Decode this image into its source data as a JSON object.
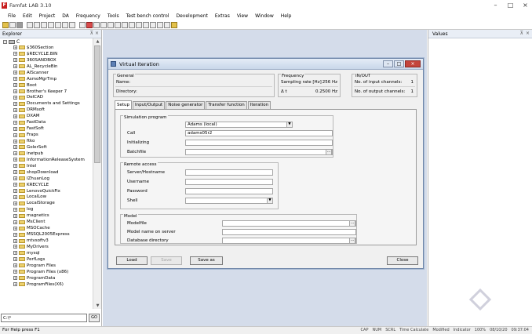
{
  "app": {
    "title": "Famfat LAB 3.10",
    "logo_letter": "F"
  },
  "window_controls": [
    "–",
    "□",
    "×"
  ],
  "menu": [
    "File",
    "Edit",
    "Project",
    "DA",
    "Frequency",
    "Tools",
    "Test bench control",
    "Development",
    "Extras",
    "View",
    "Window",
    "Help"
  ],
  "explorer": {
    "title": "Explorer",
    "pin": "⊼",
    "close": "×",
    "root": "C",
    "items": [
      "$360Section",
      "$RECYCLE.BIN",
      "360SANDBOX",
      "AL_RecycleBin",
      "AIScanner",
      "AsmoMgrTmp",
      "Boot",
      "Brother's Keeper 7",
      "DelCAD",
      "Documents and Settings",
      "DRMsoft",
      "DXAM",
      "FastData",
      "FastSoft",
      "Fraps",
      "ftko",
      "GolerSoft",
      "inetpub",
      "InformationReleaseSystem",
      "Intel",
      "shopDownload",
      "IZhuanLog",
      "KRECYCLE",
      "LenovoQuickFix",
      "LocalLow",
      "LocalStorage",
      "log",
      "magnetics",
      "MsClient",
      "MSOCache",
      "MSSQL2005Express",
      "mtvsoftv3",
      "MyDrivers",
      "mysql",
      "PerfLogs",
      "Program Files",
      "Program Files (x86)",
      "ProgramData",
      "ProgramFiles(X6)"
    ],
    "path": "C:\\*",
    "go": "GO"
  },
  "values_panel": {
    "title": "Values",
    "pin": "⊼",
    "close": "×"
  },
  "status": {
    "left": "For Help press F1",
    "indicators": [
      "CAP",
      "NUM",
      "SCRL",
      "Time Calculate",
      "Modified",
      "Indicator",
      "100%",
      "08/10/20",
      "09:37:04"
    ]
  },
  "dialog": {
    "title": "Virtual Iteration",
    "general": {
      "label": "General",
      "name_label": "Name:",
      "name_value": "",
      "dir_label": "Directory:",
      "dir_value": ""
    },
    "frequency": {
      "label": "Frequency",
      "sampling_label": "Sampling rate [Hz]",
      "sampling_value": "256 Hz",
      "dt_label": "Δ t",
      "dt_value": "0.2500 Hz"
    },
    "inout": {
      "label": "IN/OUT",
      "inputs_label": "No. of input channels:",
      "inputs_value": "1",
      "outputs_label": "No. of output channels:",
      "outputs_value": "1"
    },
    "tabs": [
      "Setup",
      "Input/Output",
      "Noise generator",
      "Transfer function",
      "Iteration"
    ],
    "simulation": {
      "label": "Simulation program",
      "program": "Adams (local)",
      "call_label": "Call",
      "call_value": "adams05r2",
      "init_label": "Initializing",
      "init_value": "",
      "batch_label": "Batchfile",
      "batch_value": ""
    },
    "remote": {
      "label": "Remote access",
      "server_label": "Server/Hostname",
      "user_label": "Username",
      "password_label": "Password",
      "shell_label": "Shell"
    },
    "model": {
      "label": "Model",
      "file_label": "Modelfile",
      "server_name_label": "Model name on server",
      "db_label": "Database directory"
    },
    "buttons": {
      "load": "Load",
      "save": "Save",
      "save_as": "Save as",
      "close": "Close"
    },
    "browse": "...",
    "arrow": "▼"
  }
}
